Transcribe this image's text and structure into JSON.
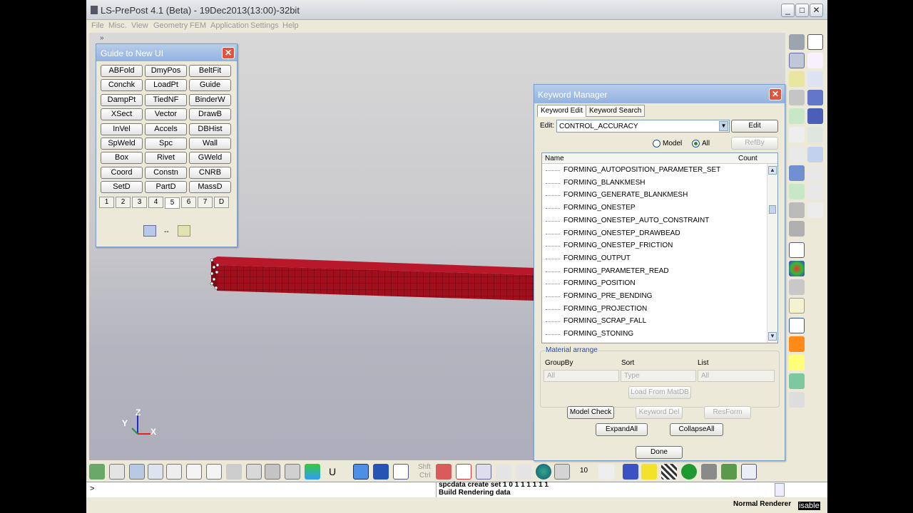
{
  "window": {
    "title": "LS-PrePost 4.1 (Beta) - 19Dec2013(13:00)-32bit",
    "min": "_",
    "max": "□",
    "close": "✕"
  },
  "menu": [
    "File",
    "Misc.",
    "View",
    "Geometry",
    "FEM",
    "Application",
    "Settings",
    "Help"
  ],
  "guide": {
    "title": "Guide to New UI",
    "close": "✕",
    "buttons": [
      "ABFold",
      "DmyPos",
      "BeltFit",
      "Conchk",
      "LoadPt",
      "Guide",
      "DampPt",
      "TiedNF",
      "BinderW",
      "XSect",
      "Vector",
      "DrawB",
      "InVel",
      "Accels",
      "DBHist",
      "SpWeld",
      "Spc",
      "Wall",
      "Box",
      "Rivet",
      "GWeld",
      "Coord",
      "Constn",
      "CNRB",
      "SetD",
      "PartD",
      "MassD"
    ],
    "tabs": [
      "1",
      "2",
      "3",
      "4",
      "5",
      "6",
      "7",
      "D"
    ],
    "active_tab": "5"
  },
  "keyword_manager": {
    "title": "Keyword Manager",
    "close": "✕",
    "tabs": [
      "Keyword Edit",
      "Keyword Search"
    ],
    "edit_label": "Edit:",
    "edit_value": "CONTROL_ACCURACY",
    "edit_button": "Edit",
    "refby_button": "RefBy",
    "radio_model": "Model",
    "radio_all": "All",
    "selected_radio": "All",
    "columns": [
      "Name",
      "Count"
    ],
    "items": [
      "FORMING_AUTOPOSITION_PARAMETER_SET",
      "FORMING_BLANKMESH",
      "FORMING_GENERATE_BLANKMESH",
      "FORMING_ONESTEP",
      "FORMING_ONESTEP_AUTO_CONSTRAINT",
      "FORMING_ONESTEP_DRAWBEAD",
      "FORMING_ONESTEP_FRICTION",
      "FORMING_OUTPUT",
      "FORMING_PARAMETER_READ",
      "FORMING_POSITION",
      "FORMING_PRE_BENDING",
      "FORMING_PROJECTION",
      "FORMING_SCRAP_FALL",
      "FORMING_STONING"
    ],
    "material_arrange": "Material arrange",
    "groupby_label": "GroupBy",
    "sort_label": "Sort",
    "list_label": "List",
    "groupby_value": "All",
    "sort_value": "Type",
    "list_value": "All",
    "load_matdb": "Load From MatDB",
    "model_check": "Model Check",
    "keyword_del": "Keyword Del",
    "resform": "ResForm",
    "expand_all": "ExpandAll",
    "collapse_all": "CollapseAll",
    "done": "Done"
  },
  "axes": {
    "z": "Z",
    "y": "Y",
    "x": "X"
  },
  "bottom_toolbar": {
    "shft": "Shft",
    "ctrl": "Ctrl",
    "u_label": "U",
    "num": "10"
  },
  "command": {
    "prompt": ">",
    "lines": [
      "spcdata create set 1 0 1 1 1 1 1 1",
      "Build Rendering data"
    ]
  },
  "status": {
    "renderer": "Normal Renderer",
    "clipped": "isable"
  },
  "colors": {
    "accent_title": "#93b2df",
    "mesh": "#a0101c",
    "viewport": "#c9c9cd"
  }
}
